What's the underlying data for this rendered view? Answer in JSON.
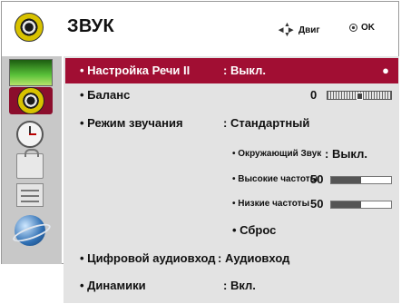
{
  "header": {
    "title": "ЗВУК",
    "move_label": "Двиг",
    "ok_label": "OK"
  },
  "sidebar": {
    "items": [
      {
        "name": "picture",
        "icon": "tv-icon"
      },
      {
        "name": "sound",
        "icon": "speaker-icon",
        "selected": true
      },
      {
        "name": "time",
        "icon": "clock-icon"
      },
      {
        "name": "lock",
        "icon": "lock-icon"
      },
      {
        "name": "option",
        "icon": "option-icon"
      },
      {
        "name": "network",
        "icon": "globe-icon"
      }
    ]
  },
  "menu": {
    "speech": {
      "label": "• Настройка Речи II",
      "value": ": Выкл."
    },
    "balance": {
      "label": "• Баланс",
      "value": "0",
      "level": 0.5
    },
    "sound_mode": {
      "label": "• Режим звучания",
      "value": ": Стандартный"
    },
    "surround": {
      "label": "• Окружающий Звук",
      "value": ": Выкл."
    },
    "treble": {
      "label": "• Высокие частоты",
      "value": "50",
      "level": 0.5
    },
    "bass": {
      "label": "• Низкие частоты",
      "value": "50",
      "level": 0.5
    },
    "reset": {
      "label": "• Сброс"
    },
    "digital_out": {
      "label": "• Цифровой аудиовход",
      "value": ": Аудиовход"
    },
    "speakers": {
      "label": "• Динамики",
      "value": ": Вкл."
    }
  },
  "colors": {
    "highlight": "#a10e33",
    "panel": "#e3e3e3",
    "sidebar": "#c8c8c8"
  }
}
